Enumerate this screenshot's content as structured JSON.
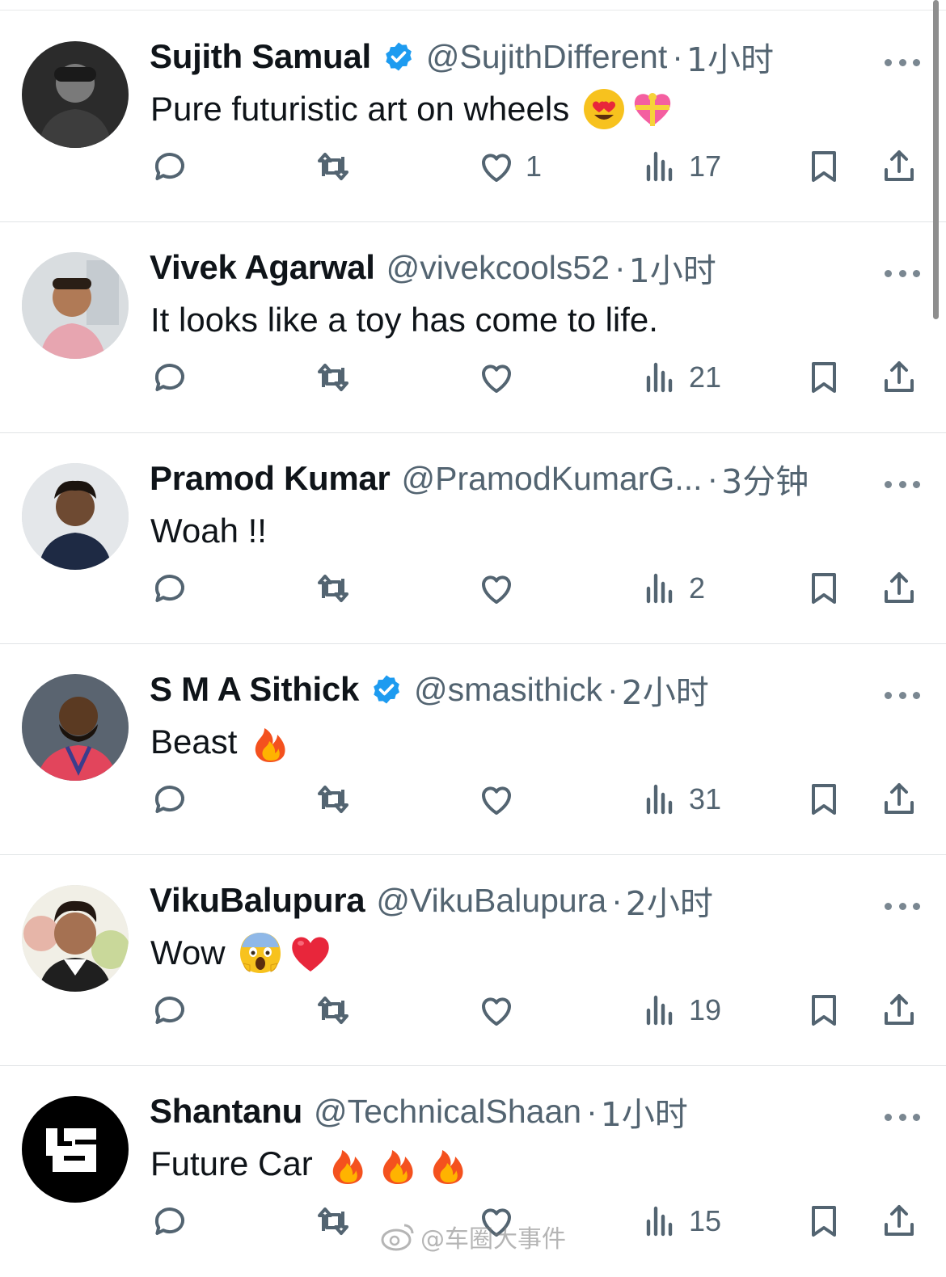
{
  "tweets": [
    {
      "name": "Sujith Samual",
      "verified": true,
      "handle": "@SujithDifferent",
      "time": "1小时",
      "text": "Pure futuristic art on wheels",
      "emojis": [
        "heart-eyes-emoji",
        "gift-heart-emoji"
      ],
      "likes": "1",
      "views": "17",
      "avatar_color": "#2b2b2b"
    },
    {
      "name": "Vivek Agarwal",
      "verified": false,
      "handle": "@vivekcools52",
      "time": "1小时",
      "text": "It looks like a toy has come to life.",
      "emojis": [],
      "likes": "",
      "views": "21",
      "avatar_color": "#d9dde0"
    },
    {
      "name": "Pramod Kumar",
      "verified": false,
      "handle": "@PramodKumarG...",
      "time": "3分钟",
      "text": "Woah !!",
      "emojis": [],
      "likes": "",
      "views": "2",
      "avatar_color": "#e4e7ea"
    },
    {
      "name": "S M A Sithick",
      "verified": true,
      "handle": "@smasithick",
      "time": "2小时",
      "text": "Beast",
      "emojis": [
        "fire-emoji"
      ],
      "likes": "",
      "views": "31",
      "avatar_color": "#5a6470"
    },
    {
      "name": "VikuBalupura",
      "verified": false,
      "handle": "@VikuBalupura",
      "time": "2小时",
      "text": "Wow",
      "emojis": [
        "screaming-face-emoji",
        "red-heart-emoji"
      ],
      "likes": "",
      "views": "19",
      "avatar_color": "#f1efe6"
    },
    {
      "name": "Shantanu",
      "verified": false,
      "handle": "@TechnicalShaan",
      "time": "1小时",
      "text": "Future Car",
      "emojis": [
        "fire-emoji",
        "fire-emoji",
        "fire-emoji"
      ],
      "likes": "",
      "views": "15",
      "avatar_color": "#000000"
    }
  ],
  "icons": {
    "reply": "reply-icon",
    "retweet": "retweet-icon",
    "like": "heart-icon",
    "views": "views-icon",
    "bookmark": "bookmark-icon",
    "share": "share-icon",
    "more": "more-icon",
    "verified": "verified-badge-icon"
  },
  "colors": {
    "verified": "#1d9bf0",
    "muted": "#536471",
    "text": "#0f1419",
    "divider": "#e7e9ea"
  },
  "watermark": {
    "text": "@车圈大事件"
  }
}
